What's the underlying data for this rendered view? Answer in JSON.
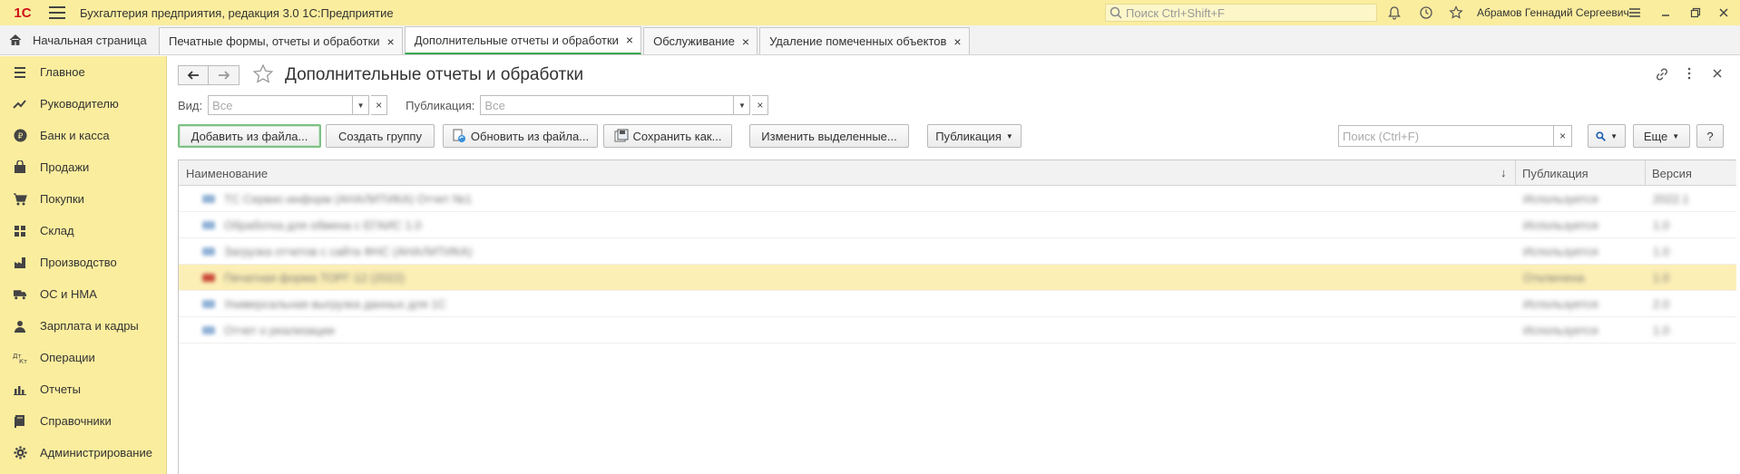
{
  "titlebar": {
    "logo": "1С",
    "app_title": "Бухгалтерия предприятия, редакция 3.0 1С:Предприятие",
    "search_placeholder": "Поиск Ctrl+Shift+F",
    "user": "Абрамов Геннадий Сергеевич"
  },
  "tabs": {
    "home": "Начальная страница",
    "items": [
      {
        "label": "Печатные формы, отчеты и обработки"
      },
      {
        "label": "Дополнительные отчеты и обработки"
      },
      {
        "label": "Обслуживание"
      },
      {
        "label": "Удаление помеченных объектов"
      }
    ]
  },
  "sidebar": {
    "items": [
      {
        "label": "Главное",
        "icon": "menu-lines-icon"
      },
      {
        "label": "Руководителю",
        "icon": "trend-icon"
      },
      {
        "label": "Банк и касса",
        "icon": "ruble-icon"
      },
      {
        "label": "Продажи",
        "icon": "bag-icon"
      },
      {
        "label": "Покупки",
        "icon": "cart-icon"
      },
      {
        "label": "Склад",
        "icon": "grid-icon"
      },
      {
        "label": "Производство",
        "icon": "factory-icon"
      },
      {
        "label": "ОС и НМА",
        "icon": "truck-icon"
      },
      {
        "label": "Зарплата и кадры",
        "icon": "person-icon"
      },
      {
        "label": "Операции",
        "icon": "dt-kt-icon"
      },
      {
        "label": "Отчеты",
        "icon": "bar-chart-icon"
      },
      {
        "label": "Справочники",
        "icon": "book-icon"
      },
      {
        "label": "Администрирование",
        "icon": "gear-icon"
      }
    ]
  },
  "form": {
    "title": "Дополнительные отчеты и обработки",
    "filter_kind_label": "Вид:",
    "filter_kind_value": "Все",
    "filter_pub_label": "Публикация:",
    "filter_pub_value": "Все",
    "buttons": {
      "add_from_file": "Добавить из файла...",
      "create_group": "Создать группу",
      "update_from_file": "Обновить из файла...",
      "save_as": "Сохранить как...",
      "change_selected": "Изменить выделенные...",
      "publication": "Публикация",
      "more": "Еще",
      "help": "?"
    },
    "search_placeholder": "Поиск (Ctrl+F)"
  },
  "table": {
    "columns": [
      "Наименование",
      "Публикация",
      "Версия"
    ],
    "rows": [
      {
        "name": "ТС Сервис-информ (АНАЛИТИКА) Отчет №1",
        "pub": "Используется",
        "ver": "2022.1"
      },
      {
        "name": "Обработка для обмена с ЕГАИС 1.0",
        "pub": "Используется",
        "ver": "1.0"
      },
      {
        "name": "Загрузка отчетов с сайта ФНС (АНАЛИТИКА)",
        "pub": "Используется",
        "ver": "1.0"
      },
      {
        "name": "Печатная форма ТОРГ-12 (2022)",
        "pub": "Отключена",
        "ver": "1.0"
      },
      {
        "name": "Универсальная выгрузка данных для 1С",
        "pub": "Используется",
        "ver": "2.0"
      },
      {
        "name": "Отчет о реализации",
        "pub": "Используется",
        "ver": "1.0"
      }
    ]
  }
}
